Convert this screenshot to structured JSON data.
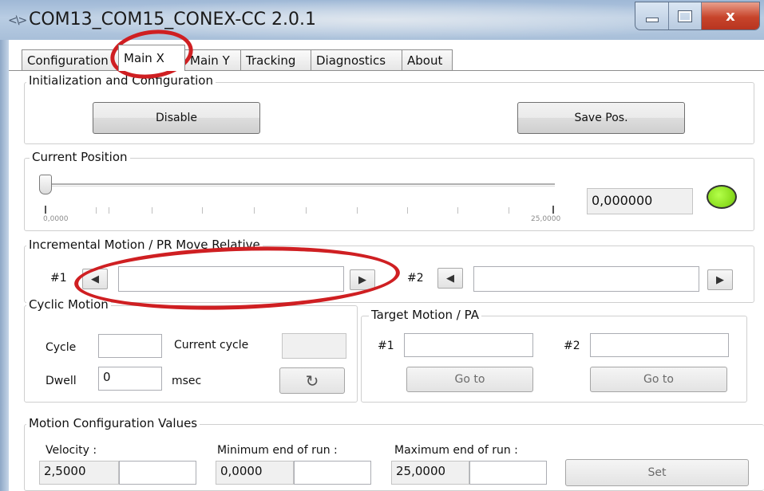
{
  "window": {
    "title": "COM13_COM15_CONEX-CC 2.0.1",
    "app_icon": "serial-link-icon",
    "controls": [
      "minimize-icon",
      "maximize-icon",
      "close-icon"
    ],
    "close_glyph": "x"
  },
  "tabs": [
    {
      "label": "Configuration",
      "active": false
    },
    {
      "label": "Main X",
      "active": true
    },
    {
      "label": "Main Y",
      "active": false
    },
    {
      "label": "Tracking",
      "active": false
    },
    {
      "label": "Diagnostics",
      "active": false
    },
    {
      "label": "About",
      "active": false
    }
  ],
  "init_config": {
    "legend": "Initialization and Configuration",
    "disable_label": "Disable",
    "save_pos_label": "Save Pos."
  },
  "current_position": {
    "legend": "Current Position",
    "slider_min_label": "0,0000",
    "slider_max_label": "25,0000",
    "slider_value": 0,
    "value": "0,000000",
    "status_color": "#8ee022"
  },
  "incremental": {
    "legend": "Incremental Motion / PR Move Relative",
    "label1": "#1",
    "label2": "#2",
    "left_arrow": "◀",
    "right_arrow": "▶",
    "value1": "",
    "value2": ""
  },
  "cyclic": {
    "legend": "Cyclic Motion",
    "cycle_label": "Cycle",
    "cycle_value": "",
    "current_cycle_label": "Current cycle",
    "current_cycle_value": "",
    "dwell_label": "Dwell",
    "dwell_value": "0",
    "dwell_unit": "msec",
    "reset_glyph": "↻"
  },
  "target": {
    "legend": "Target Motion / PA",
    "label1": "#1",
    "label2": "#2",
    "value1": "",
    "value2": "",
    "goto1_label": "Go to",
    "goto2_label": "Go to"
  },
  "motion_config": {
    "legend": "Motion Configuration Values",
    "velocity_label": "Velocity :",
    "velocity_value": "2,5000",
    "min_label": "Minimum end of run :",
    "min_value": "0,0000",
    "max_label": "Maximum end of run :",
    "max_value": "25,0000",
    "set_label": "Set"
  },
  "annotation_color": "#cf1f22"
}
